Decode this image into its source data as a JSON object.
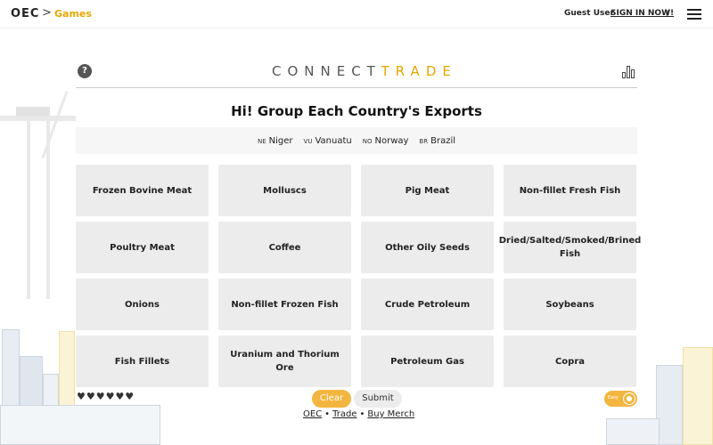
{
  "nav": {
    "logo": "OEC",
    "separator": ">",
    "breadcrumb": "Games",
    "guest": "Guest User",
    "signin": "SIGN IN NOW!",
    "theme_icon": "moon-icon",
    "menu_icon": "hamburger-menu-icon"
  },
  "game": {
    "title_part1": "CONNECT",
    "title_part2": "TRADE",
    "headline": "Hi! Group Each Country's Exports",
    "help_icon": "question-icon",
    "stats_icon": "bar-chart-icon",
    "countries": [
      {
        "code": "NE",
        "name": "Niger"
      },
      {
        "code": "VU",
        "name": "Vanuatu"
      },
      {
        "code": "NO",
        "name": "Norway"
      },
      {
        "code": "BR",
        "name": "Brazil"
      }
    ],
    "tiles": [
      "Frozen Bovine Meat",
      "Molluscs",
      "Pig Meat",
      "Non-fillet Fresh Fish",
      "Poultry Meat",
      "Coffee",
      "Other Oily Seeds",
      "Dried/Salted/Smoked/Brined Fish",
      "Onions",
      "Non-fillet Frozen Fish",
      "Crude Petroleum",
      "Soybeans",
      "Fish Fillets",
      "Uranium and Thorium Ore",
      "Petroleum Gas",
      "Copra"
    ],
    "lives_remaining": 6,
    "hearts": "♥♥♥♥♥♥",
    "clear_label": "Clear",
    "submit_label": "Submit",
    "toggle_label": "Easy",
    "toggle_on": true
  },
  "footer": {
    "link1": "OEC",
    "link2": "Trade",
    "link3": "Buy Merch",
    "sep": "•"
  },
  "colors": {
    "accent": "#e6a700",
    "button_accent": "#f2b640",
    "tile_bg": "#ececec"
  }
}
